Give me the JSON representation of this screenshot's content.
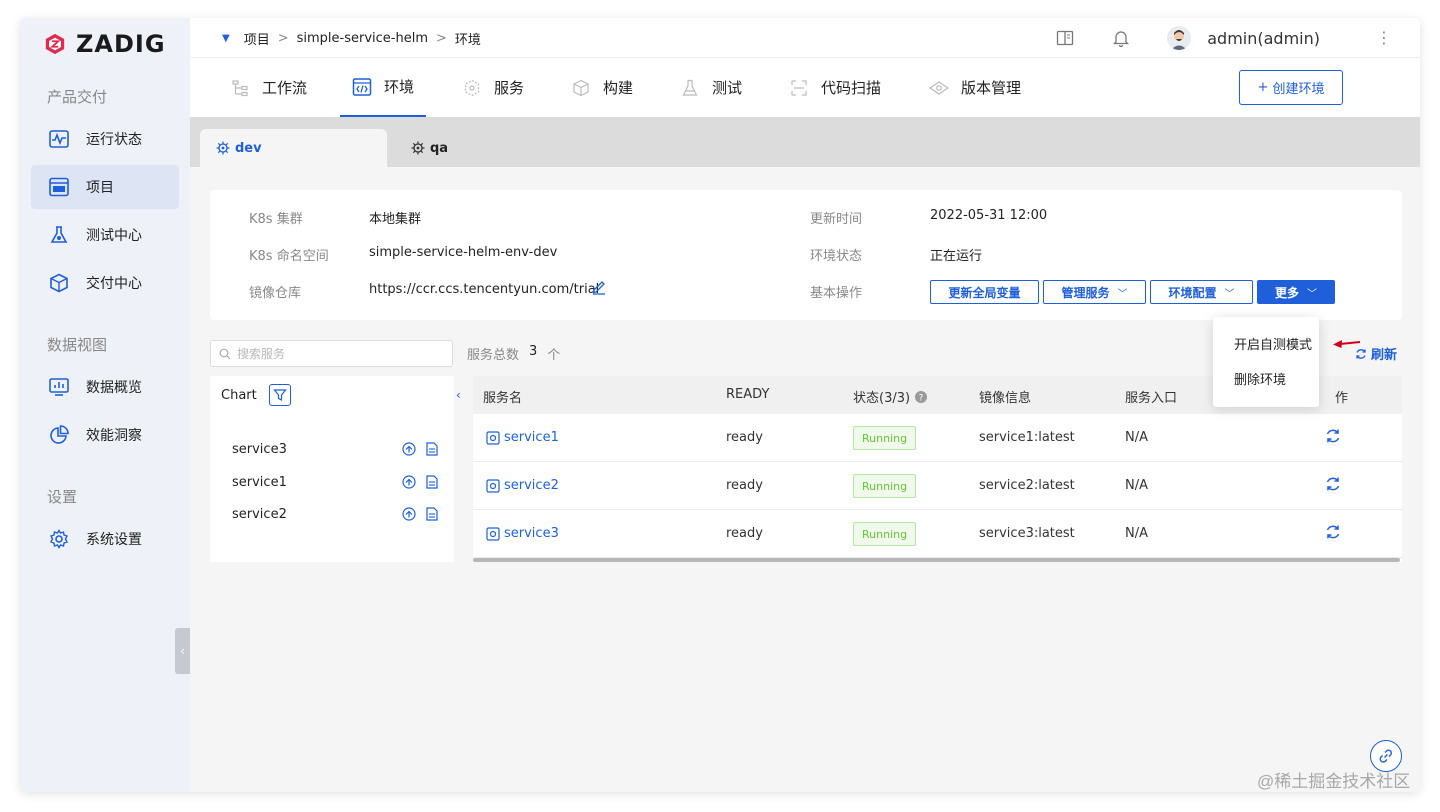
{
  "brand": {
    "name": "ZADIG",
    "color": "#e0294f",
    "accent": "#1f5fd9"
  },
  "sidebar": {
    "sections": [
      {
        "title": "产品交付"
      },
      {
        "title": "数据视图"
      },
      {
        "title": "设置"
      }
    ],
    "items": [
      {
        "label": "运行状态",
        "icon": "pulse-monitor-icon"
      },
      {
        "label": "项目",
        "icon": "pm-project-icon",
        "active": true
      },
      {
        "label": "测试中心",
        "icon": "flask-icon"
      },
      {
        "label": "交付中心",
        "icon": "package-box-icon"
      },
      {
        "label": "数据概览",
        "icon": "bar-chart-screen-icon"
      },
      {
        "label": "效能洞察",
        "icon": "pie-chart-icon"
      },
      {
        "label": "系统设置",
        "icon": "gear-icon"
      }
    ]
  },
  "breadcrumb": {
    "root": "项目",
    "project": "simple-service-helm",
    "page": "环境"
  },
  "user": {
    "name": "admin(admin)"
  },
  "nav_tabs": [
    {
      "label": "工作流",
      "icon": "workflow-icon"
    },
    {
      "label": "环境",
      "icon": "code-env-icon",
      "active": true
    },
    {
      "label": "服务",
      "icon": "hexagon-service-icon"
    },
    {
      "label": "构建",
      "icon": "cube-build-icon"
    },
    {
      "label": "测试",
      "icon": "flask-test-icon"
    },
    {
      "label": "代码扫描",
      "icon": "scan-frame-icon"
    },
    {
      "label": "版本管理",
      "icon": "eye-version-icon"
    }
  ],
  "create_env_button": "创建环境",
  "env_tabs": [
    {
      "label": "dev",
      "active": true
    },
    {
      "label": "qa"
    }
  ],
  "env_info": {
    "cluster_label": "K8s 集群",
    "cluster_value": "本地集群",
    "namespace_label": "K8s 命名空间",
    "namespace_value": "simple-service-helm-env-dev",
    "registry_label": "镜像仓库",
    "registry_value": "https://ccr.ccs.tencentyun.com/trial",
    "updated_label": "更新时间",
    "updated_value": "2022-05-31 12:00",
    "status_label": "环境状态",
    "status_value": "正在运行",
    "ops_label": "基本操作"
  },
  "ops_buttons": {
    "update_vars": "更新全局变量",
    "manage_services": "管理服务",
    "env_config": "环境配置",
    "more": "更多"
  },
  "search": {
    "placeholder": "搜索服务"
  },
  "service_total": {
    "label": "服务总数",
    "count": "3",
    "unit": "个"
  },
  "refresh_label": "刷新",
  "chart_panel": {
    "title": "Chart",
    "rows": [
      "service3",
      "service1",
      "service2"
    ]
  },
  "table": {
    "headers": {
      "name": "服务名",
      "ready": "READY",
      "status": "状态(3/3)",
      "image": "镜像信息",
      "entry": "服务入口",
      "ops": "作"
    },
    "rows": [
      {
        "name": "service1",
        "ready": "ready",
        "status": "Running",
        "image": "service1:latest",
        "entry": "N/A"
      },
      {
        "name": "service2",
        "ready": "ready",
        "status": "Running",
        "image": "service2:latest",
        "entry": "N/A"
      },
      {
        "name": "service3",
        "ready": "ready",
        "status": "Running",
        "image": "service3:latest",
        "entry": "N/A"
      }
    ]
  },
  "more_menu": {
    "items": [
      "开启自测模式",
      "删除环境"
    ]
  },
  "watermark": "@稀土掘金技术社区"
}
